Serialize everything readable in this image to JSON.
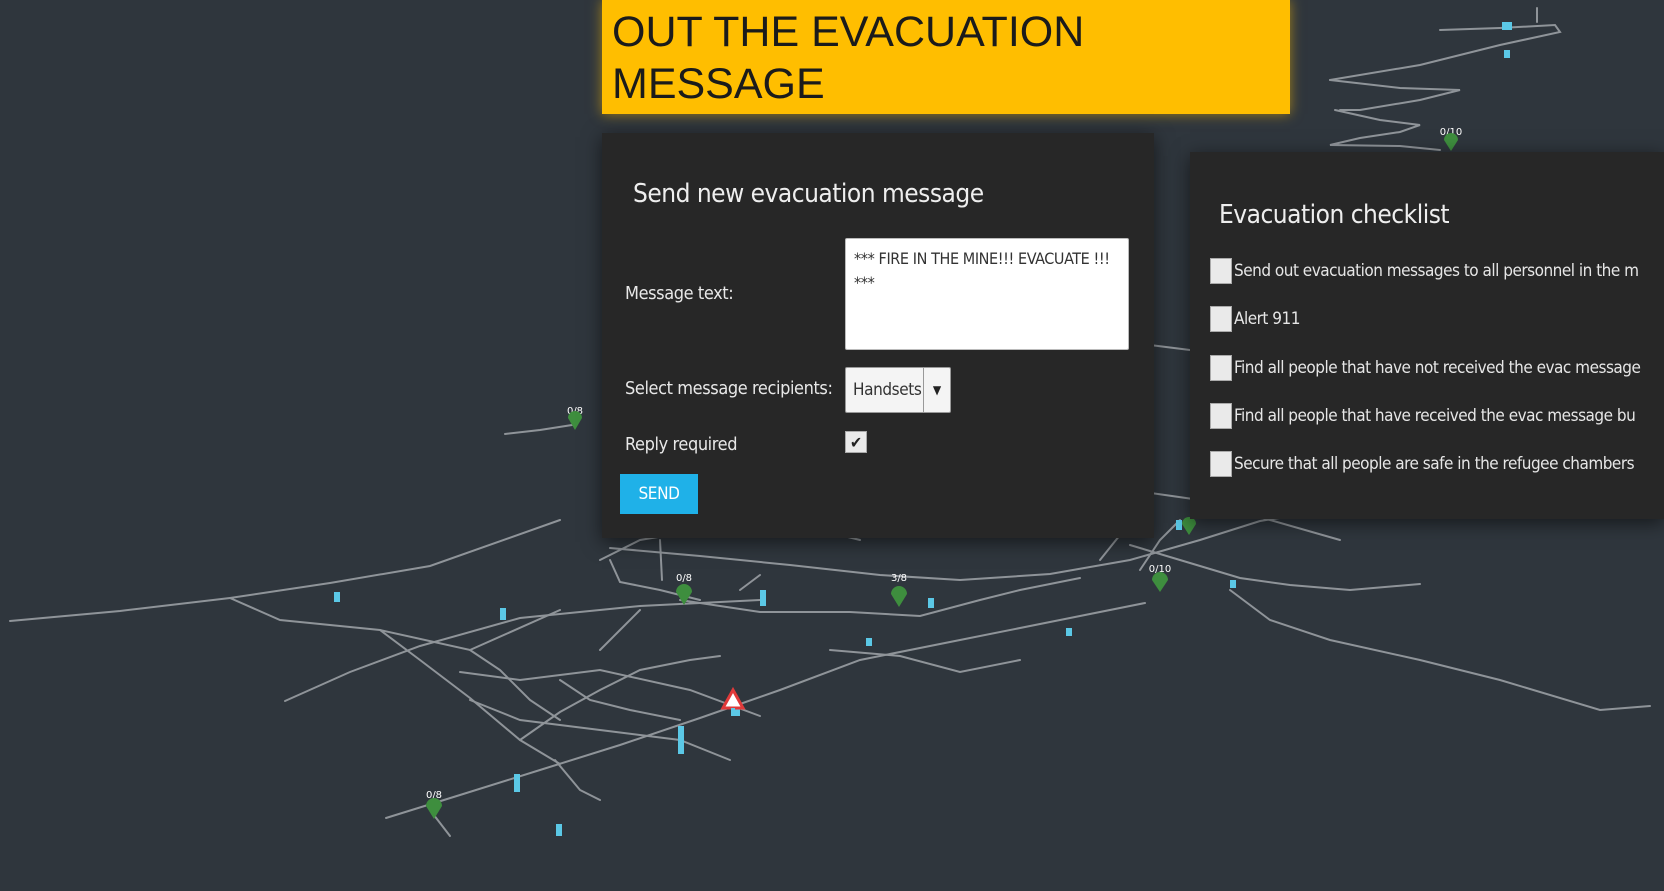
{
  "banner": {
    "line1": "OUT THE EVACUATION",
    "line2": "MESSAGE"
  },
  "send_panel": {
    "title": "Send new evacuation message",
    "message_label": "Message text:",
    "message_value": "*** FIRE IN THE MINE!!! EVACUATE !!! ***",
    "recipients_label": "Select message recipients:",
    "recipients_selected": "Handsets",
    "reply_label": "Reply required",
    "reply_checked": true,
    "send_label": "SEND"
  },
  "checklist": {
    "title": "Evacuation checklist",
    "items": [
      {
        "label": "Send out evacuation messages to all personnel in the m",
        "checked": false
      },
      {
        "label": "Alert 911",
        "checked": false
      },
      {
        "label": "Find all people that have not received the evac message",
        "checked": false
      },
      {
        "label": "Find all people that have received the evac message bu",
        "checked": false
      },
      {
        "label": "Secure that all people are safe in the refugee chambers",
        "checked": false
      }
    ]
  },
  "map": {
    "markers": [
      {
        "label": "0/8"
      },
      {
        "label": "0/8"
      },
      {
        "label": "3/8"
      },
      {
        "label": "0/10"
      },
      {
        "label": "0/10"
      },
      {
        "label": "0/8"
      }
    ],
    "colors": {
      "tunnel": "#8f9499",
      "refuge": "#3e8e3e",
      "sensor": "#5bc8e6",
      "alert": "#e03a3a"
    }
  }
}
